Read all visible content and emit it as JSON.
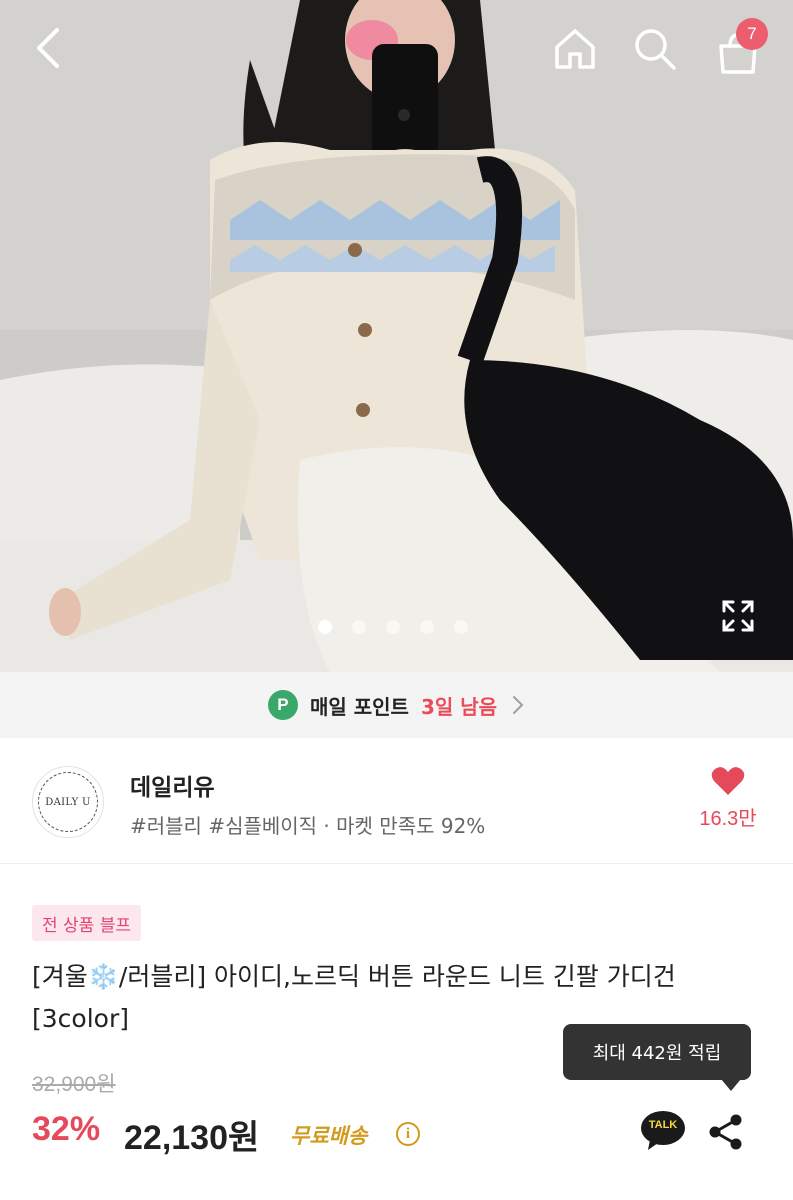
{
  "header": {
    "cart_count": "7"
  },
  "gallery": {
    "slide_count": 5,
    "active_slide": 1
  },
  "points_banner": {
    "icon_letter": "P",
    "label": "매일 포인트",
    "remaining": "3일 남음"
  },
  "store": {
    "logo_text": "DAILY U",
    "name": "데일리유",
    "tags": "#러블리 #심플베이직 · 마켓 만족도 92%",
    "like_count": "16.3만"
  },
  "product": {
    "badge": "전 상품 블프",
    "title_prefix": "[겨울",
    "title_emoji": "❄️",
    "title_suffix": "/러블리] 아이디,노르딕 버튼 라운드 니트 긴팔 가디건 [3color]",
    "tooltip": "최대 442원 적립",
    "original_price": "32,900원",
    "discount_rate": "32%",
    "sale_price": "22,130원",
    "shipping": "무료배송",
    "info_icon_glyph": "i",
    "talk_label": "TALK"
  },
  "colors": {
    "accent_red": "#e64a5a",
    "points_green": "#3aa86b",
    "shipping_gold": "#d29b1e",
    "badge_bg": "#fde7ef"
  },
  "icons": [
    "back-arrow-icon",
    "home-icon",
    "search-icon",
    "shopping-bag-icon",
    "expand-icon",
    "chevron-right-icon",
    "heart-icon",
    "info-icon",
    "kakao-talk-icon",
    "share-icon"
  ]
}
